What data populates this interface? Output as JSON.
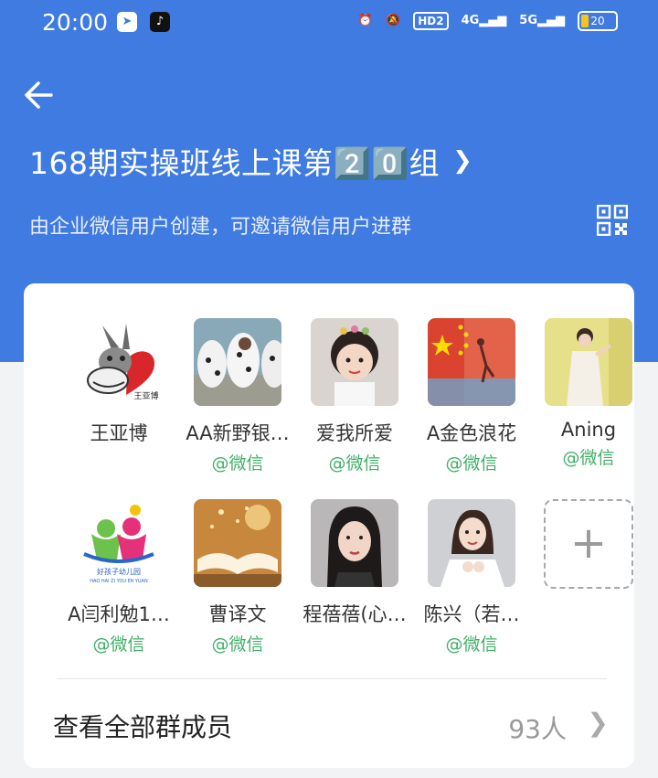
{
  "status_bar": {
    "time": "20:00",
    "hd_label": "HD2",
    "net1": "4G",
    "net2": "5G",
    "battery": "20"
  },
  "header": {
    "title": "168期实操班线上课第2️⃣0️⃣组",
    "subtitle": "由企业微信用户创建，可邀请微信用户进群"
  },
  "members": [
    {
      "name": "王亚博",
      "tag": ""
    },
    {
      "name": "AA新野银…",
      "tag": "@微信"
    },
    {
      "name": "爱我所爱",
      "tag": "@微信"
    },
    {
      "name": "A金色浪花",
      "tag": "@微信"
    },
    {
      "name": "Aning",
      "tag": "@微信"
    },
    {
      "name": "A闫利勉1…",
      "tag": "@微信"
    },
    {
      "name": "曹译文",
      "tag": "@微信"
    },
    {
      "name": "程蓓蓓(心…",
      "tag": ""
    },
    {
      "name": "陈兴（若…",
      "tag": "@微信"
    }
  ],
  "avatar_texts": {
    "donkey_label": "王亚博",
    "kindergarten_cn": "好孩子幼儿园",
    "kindergarten_en": "HAO HAI ZI YOU ER YUAN"
  },
  "add_button": {
    "symbol": "+"
  },
  "all_members": {
    "label": "查看全部群成员",
    "count": "93人"
  },
  "colors": {
    "header": "#3f7be0",
    "wechat_tag": "#3fb067"
  }
}
